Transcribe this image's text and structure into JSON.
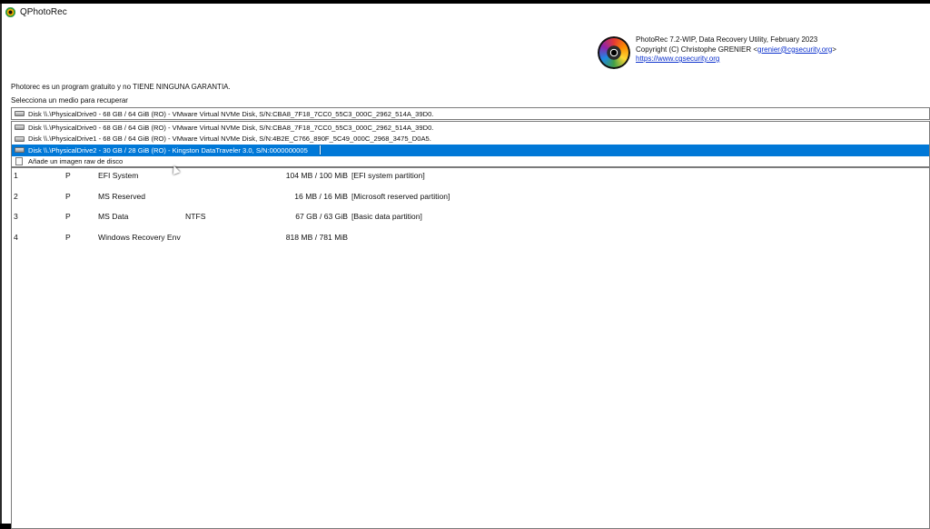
{
  "window": {
    "title": "QPhotoRec"
  },
  "about": {
    "line1": "PhotoRec 7.2-WIP, Data Recovery Utility, February 2023",
    "line2_prefix": "Copyright (C) Christophe GRENIER <",
    "email": "grenier@cgsecurity.org",
    "line2_suffix": ">",
    "url": "https://www.cgsecurity.org"
  },
  "intro_text": "Photorec es un program gratuito y no TIENE NINGUNA GARANTIA.",
  "select_label": "Selecciona un medio para recuperar",
  "combo": {
    "current": "Disk \\\\.\\PhysicalDrive0 - 68 GB / 64 GiB (RO) - VMware Virtual NVMe Disk, S/N:CBA8_7F18_7CC0_55C3_000C_2962_514A_39D0."
  },
  "dropdown": {
    "items": [
      {
        "icon": "disk-icon",
        "label": "Disk \\\\.\\PhysicalDrive0 - 68 GB / 64 GiB (RO) - VMware Virtual NVMe Disk, S/N:CBA8_7F18_7CC0_55C3_000C_2962_514A_39D0."
      },
      {
        "icon": "disk-icon",
        "label": "Disk \\\\.\\PhysicalDrive1 - 68 GB / 64 GiB (RO) - VMware Virtual NVMe Disk, S/N:4B2E_C766_890F_5C49_000C_2968_3475_D0A5."
      },
      {
        "icon": "disk-icon",
        "label": "Disk \\\\.\\PhysicalDrive2 - 30 GB / 28 GiB (RO) - Kingston DataTraveler 3.0, S/N:0000000005"
      },
      {
        "icon": "file-icon",
        "label": "Añade un imagen raw de disco"
      }
    ],
    "selected_index": 2
  },
  "partitions": [
    {
      "num": "1",
      "type": "P",
      "name": "EFI System",
      "fs": "",
      "size": "104 MB / 100 MiB",
      "desc": "[EFI system partition]"
    },
    {
      "num": "2",
      "type": "P",
      "name": "MS Reserved",
      "fs": "",
      "size": "16 MB / 16 MiB",
      "desc": "[Microsoft reserved partition]"
    },
    {
      "num": "3",
      "type": "P",
      "name": "MS Data",
      "fs": "NTFS",
      "size": "67 GB / 63 GiB",
      "desc": "[Basic data partition]"
    },
    {
      "num": "4",
      "type": "P",
      "name": "Windows Recovery Env",
      "fs": "",
      "size": "818 MB / 781 MiB",
      "desc": ""
    }
  ],
  "colors": {
    "selection": "#0078d7",
    "link": "#0a2fcc"
  }
}
